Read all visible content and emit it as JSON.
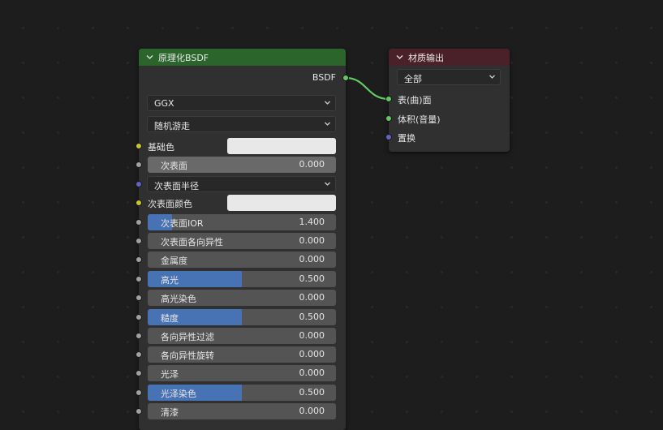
{
  "bsdf_node": {
    "title": "原理化BSDF",
    "header_color": "#2b652b",
    "output_label": "BSDF",
    "distribution": "GGX",
    "subsurface_method": "随机游走",
    "inputs": [
      {
        "kind": "color",
        "label": "基础色",
        "socket": "yellow"
      },
      {
        "kind": "slider",
        "label": "次表面",
        "value": "0.000",
        "fraction": 0,
        "socket": "gray",
        "hover": true
      },
      {
        "kind": "dropdown",
        "label": "次表面半径",
        "socket": "purple"
      },
      {
        "kind": "color",
        "label": "次表面颜色",
        "socket": "yellow"
      },
      {
        "kind": "slider",
        "label": "次表面IOR",
        "value": "1.400",
        "fraction": 0.13,
        "socket": "gray"
      },
      {
        "kind": "slider",
        "label": "次表面各向异性",
        "value": "0.000",
        "fraction": 0,
        "socket": "gray"
      },
      {
        "kind": "slider",
        "label": "金属度",
        "value": "0.000",
        "fraction": 0,
        "socket": "gray"
      },
      {
        "kind": "slider",
        "label": "高光",
        "value": "0.500",
        "fraction": 0.5,
        "socket": "gray"
      },
      {
        "kind": "slider",
        "label": "高光染色",
        "value": "0.000",
        "fraction": 0,
        "socket": "gray"
      },
      {
        "kind": "slider",
        "label": "糙度",
        "value": "0.500",
        "fraction": 0.5,
        "socket": "gray"
      },
      {
        "kind": "slider",
        "label": "各向异性过滤",
        "value": "0.000",
        "fraction": 0,
        "socket": "gray"
      },
      {
        "kind": "slider",
        "label": "各向异性旋转",
        "value": "0.000",
        "fraction": 0,
        "socket": "gray"
      },
      {
        "kind": "slider",
        "label": "光泽",
        "value": "0.000",
        "fraction": 0,
        "socket": "gray"
      },
      {
        "kind": "slider",
        "label": "光泽染色",
        "value": "0.500",
        "fraction": 0.5,
        "socket": "gray"
      },
      {
        "kind": "slider",
        "label": "清漆",
        "value": "0.000",
        "fraction": 0,
        "socket": "gray"
      }
    ]
  },
  "output_node": {
    "title": "材质输出",
    "header_color": "#4a2029",
    "target": "全部",
    "inputs": [
      {
        "label": "表(曲)面",
        "socket": "green"
      },
      {
        "label": "体积(音量)",
        "socket": "green"
      },
      {
        "label": "置换",
        "socket": "purple"
      }
    ]
  },
  "colors": {
    "link": "#63c763",
    "slider_fill": "#4772b3"
  }
}
